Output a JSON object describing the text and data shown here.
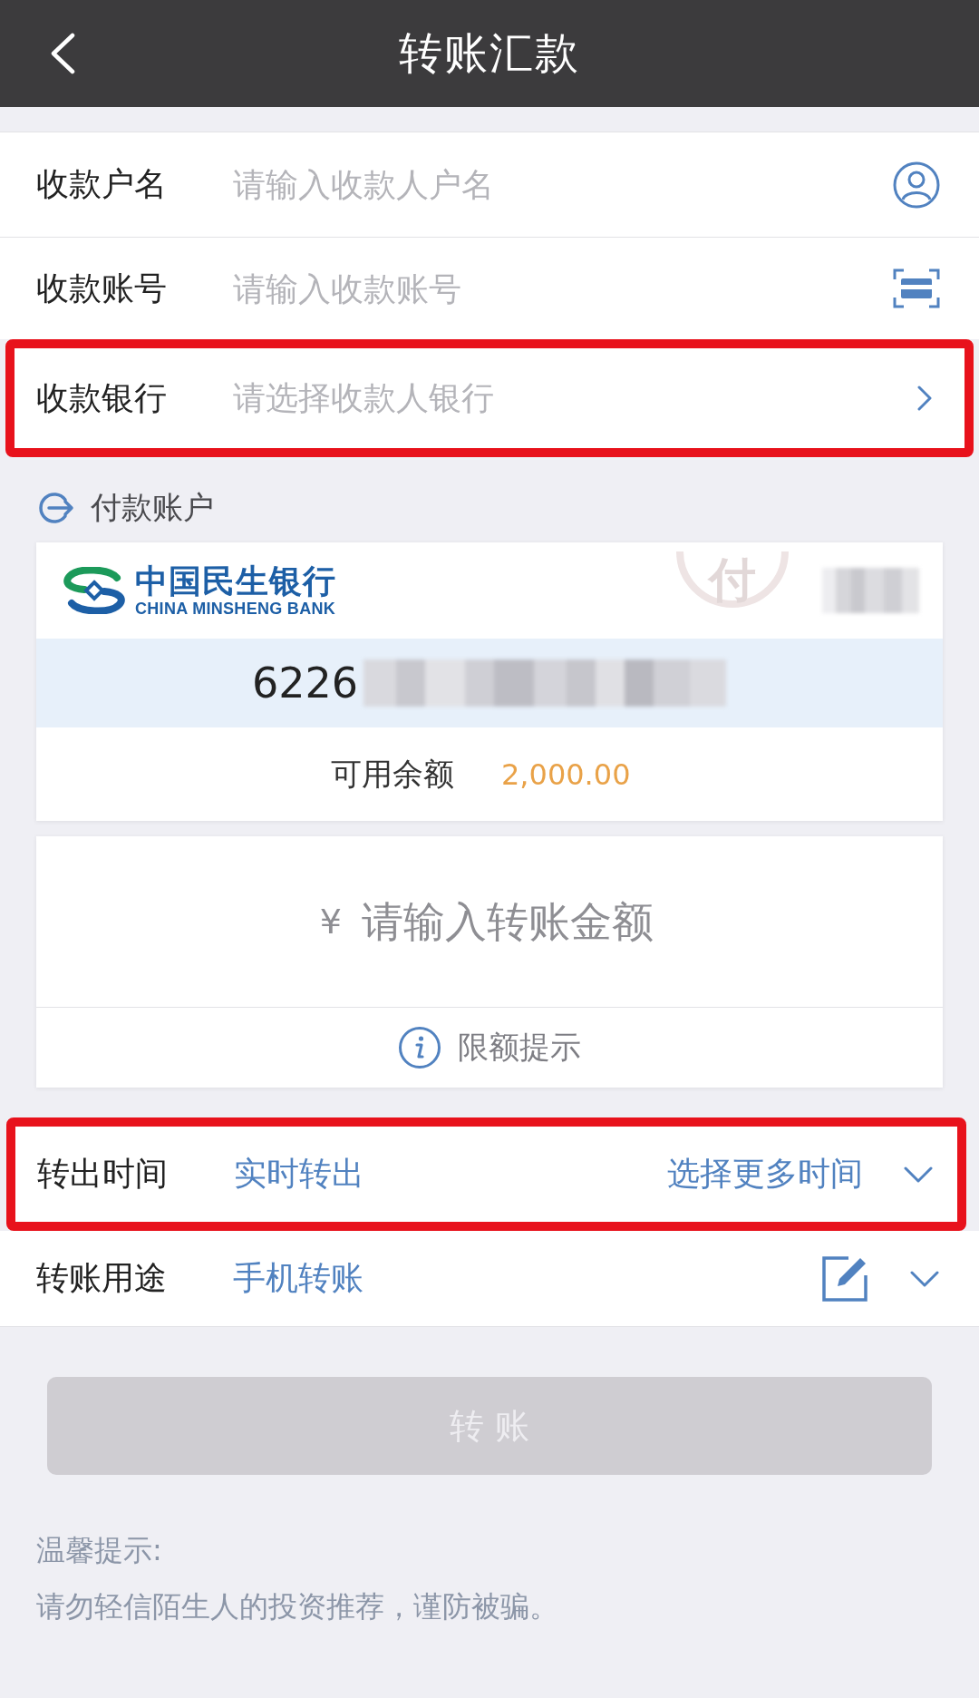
{
  "header": {
    "title": "转账汇款"
  },
  "payee_fields": [
    {
      "kind": "contact",
      "label": "收款户名",
      "placeholder": "请输入收款人户名",
      "highlighted": false
    },
    {
      "kind": "scan",
      "label": "收款账号",
      "placeholder": "请输入收款账号",
      "highlighted": false
    },
    {
      "kind": "picker",
      "label": "收款银行",
      "placeholder": "请选择收款人银行",
      "highlighted": true
    }
  ],
  "payer": {
    "title": "付款账户",
    "card": {
      "bank_name": "中国民生银行",
      "bank_name_en": "CHINA MINSHENG BANK",
      "stamp": "付",
      "account_number": "6226",
      "balance_label": "可用余额",
      "balance": "2,000.00"
    }
  },
  "amount": {
    "currency": "¥",
    "placeholder": "请输入转账金额",
    "limit_hint": "限额提示"
  },
  "options": [
    {
      "kind": "time",
      "label": "转出时间",
      "value": "实时转出",
      "action": "选择更多时间",
      "highlighted": true
    },
    {
      "kind": "purpose",
      "label": "转账用途",
      "value": "手机转账",
      "highlighted": false
    }
  ],
  "submit": {
    "label": "转 账",
    "disabled": true
  },
  "notice": {
    "title": "温馨提示:",
    "text": "请勿轻信陌生人的投资推荐，谨防被骗。"
  }
}
